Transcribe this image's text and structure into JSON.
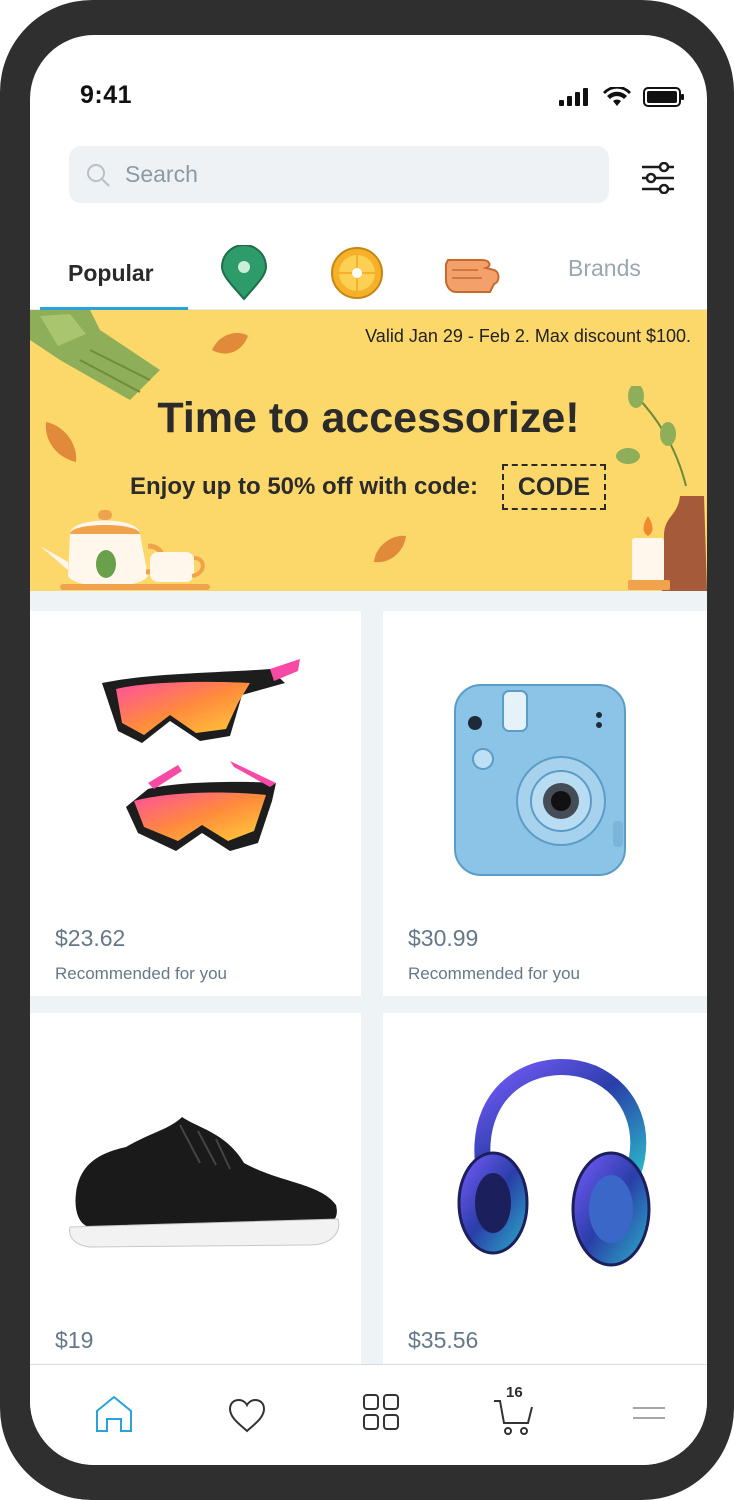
{
  "status": {
    "time": "9:41"
  },
  "search": {
    "placeholder": "Search"
  },
  "tabs": {
    "popular": "Popular",
    "brands": "Brands"
  },
  "banner": {
    "valid": "Valid Jan 29 - Feb 2. Max discount $100.",
    "title": "Time to accessorize!",
    "subtitle": "Enjoy up to 50% off with code:",
    "code": "CODE"
  },
  "products": [
    {
      "price": "$23.62",
      "note": "Recommended for you",
      "icon": "sunglasses-image"
    },
    {
      "price": "$30.99",
      "note": "Recommended for you",
      "icon": "instant-camera-image"
    },
    {
      "price": "$19",
      "note": "",
      "icon": "sneaker-image"
    },
    {
      "price": "$35.56",
      "note": "",
      "icon": "headphones-image"
    }
  ],
  "nav": {
    "cart_count": "16"
  },
  "colors": {
    "accent": "#2aa3dc",
    "banner": "#fcd86a",
    "frame": "#2f2f2f"
  }
}
